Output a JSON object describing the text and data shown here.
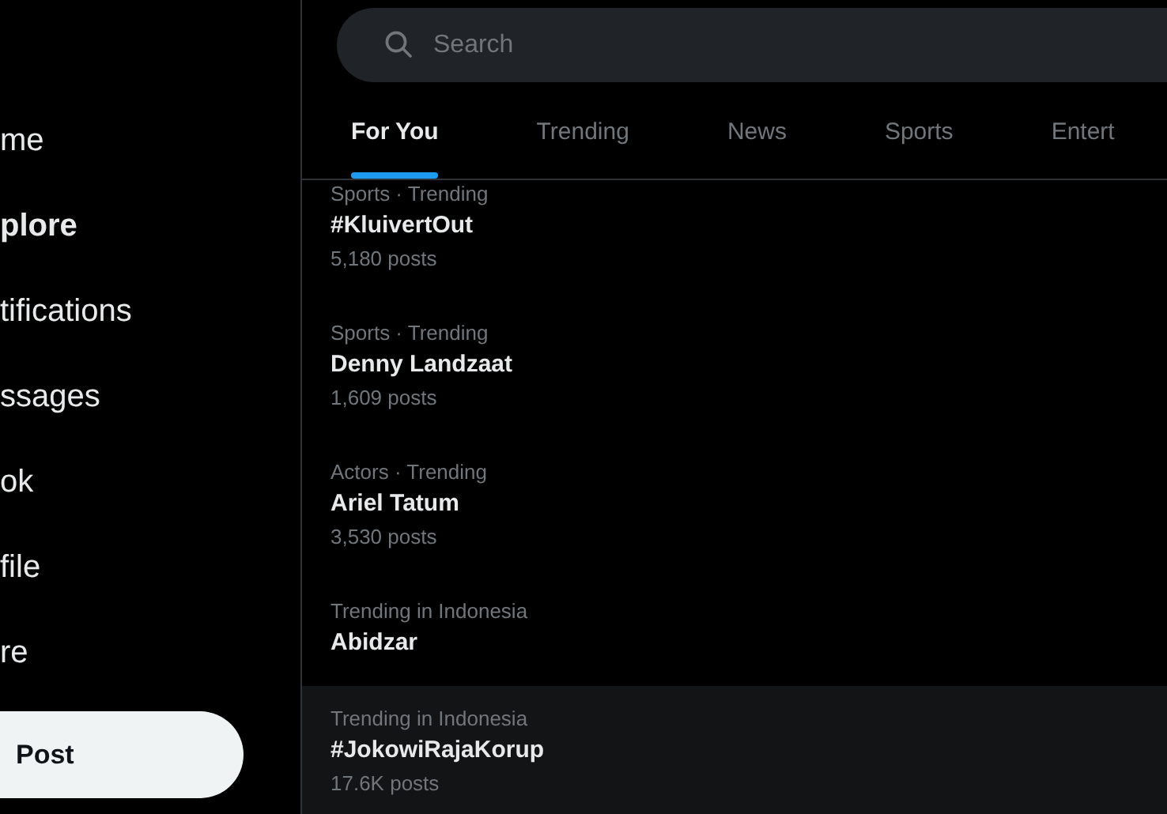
{
  "sidebar": {
    "items": [
      {
        "label": "me",
        "selected": false
      },
      {
        "label": "plore",
        "selected": true
      },
      {
        "label": "tifications",
        "selected": false
      },
      {
        "label": "ssages",
        "selected": false
      },
      {
        "label": "ok",
        "selected": false
      },
      {
        "label": "file",
        "selected": false
      },
      {
        "label": "re",
        "selected": false
      }
    ],
    "post_button": "Post"
  },
  "search": {
    "placeholder": "Search"
  },
  "tabs": [
    {
      "label": "For You",
      "selected": true
    },
    {
      "label": "Trending",
      "selected": false
    },
    {
      "label": "News",
      "selected": false
    },
    {
      "label": "Sports",
      "selected": false
    },
    {
      "label": "Entert",
      "selected": false
    }
  ],
  "trends": [
    {
      "category": "Sports · Trending",
      "title": "#KluivertOut",
      "posts": "5,180 posts",
      "highlighted": false
    },
    {
      "category": "Sports · Trending",
      "title": "Denny Landzaat",
      "posts": "1,609 posts",
      "highlighted": false
    },
    {
      "category": "Actors · Trending",
      "title": "Ariel Tatum",
      "posts": "3,530 posts",
      "highlighted": false
    },
    {
      "category": "Trending in Indonesia",
      "title": "Abidzar",
      "highlighted": false
    },
    {
      "category": "Trending in Indonesia",
      "title": "#JokowiRajaKorup",
      "posts": "17.6K posts",
      "highlighted": true
    }
  ]
}
